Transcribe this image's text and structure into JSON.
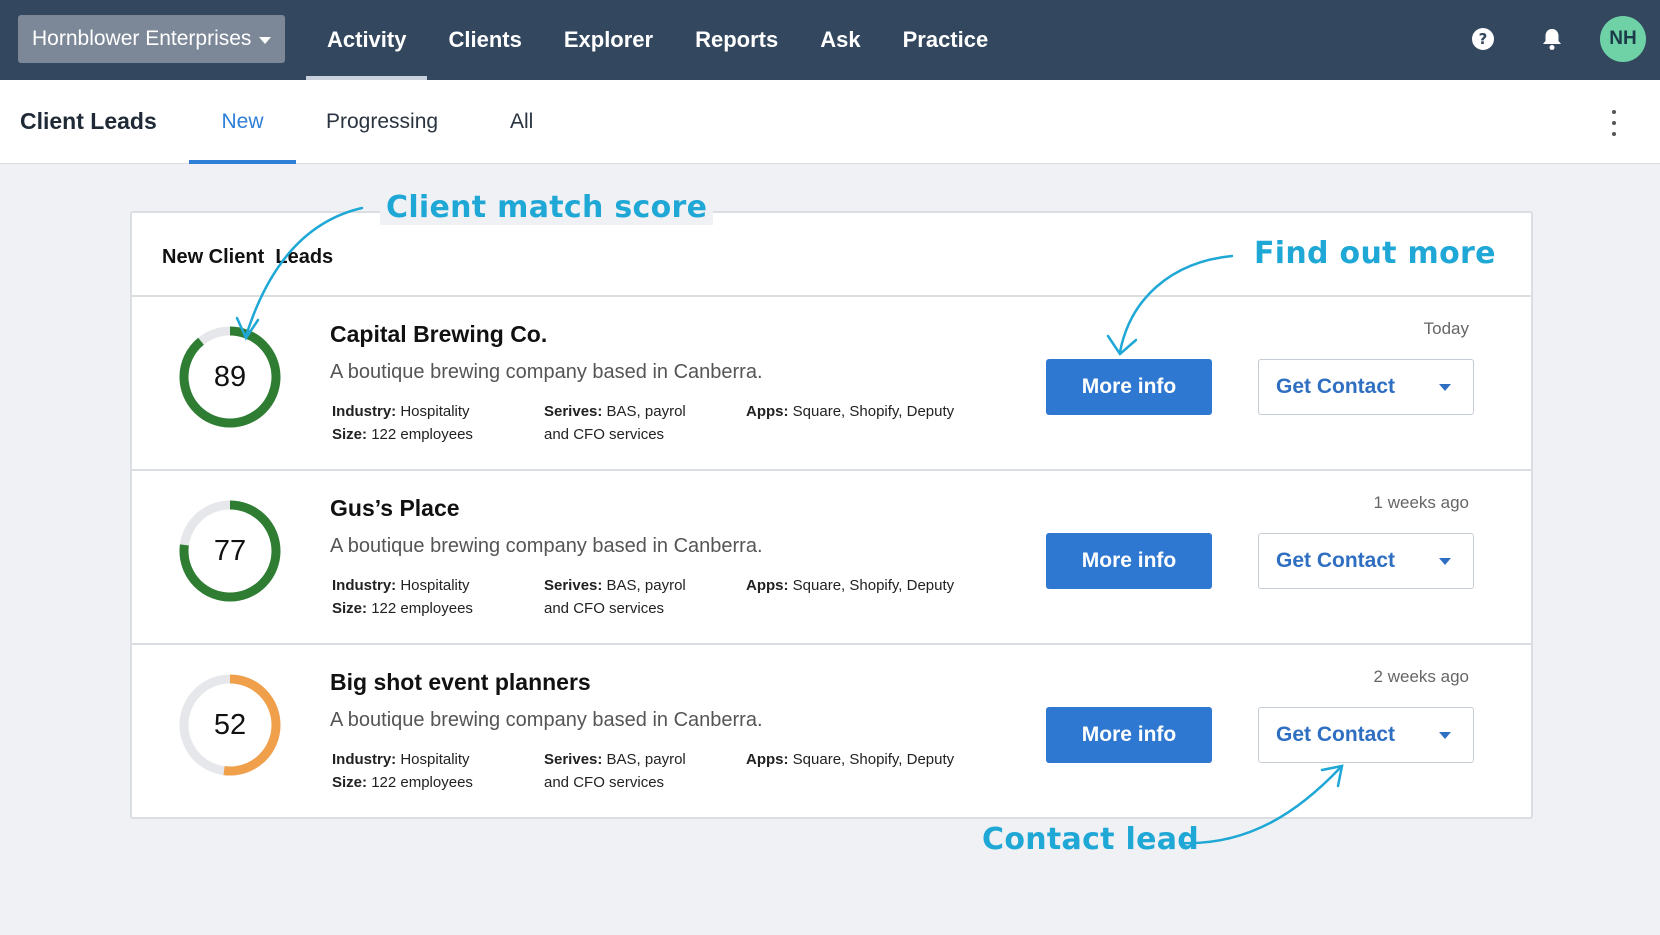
{
  "topbar": {
    "org_name": "Hornblower Enterprises",
    "nav": [
      "Activity",
      "Clients",
      "Explorer",
      "Reports",
      "Ask",
      "Practice"
    ],
    "active_nav": "Activity",
    "avatar_initials": "NH",
    "help_icon": "help-circle-icon",
    "bell_icon": "bell-icon"
  },
  "subheader": {
    "title": "Client Leads",
    "tabs": [
      "New",
      "Progressing",
      "All"
    ],
    "active_tab": "New"
  },
  "panel": {
    "title": "New Client  Leads",
    "leads": [
      {
        "score": 89,
        "score_color": "#2e7d32",
        "name": "Capital Brewing Co.",
        "description": "A boutique brewing company based in Canberra.",
        "industry_label": "Industry:",
        "industry": "Hospitality",
        "size_label": "Size:",
        "size": "122 employees",
        "serves_label": "Serives:",
        "serves_line1": "BAS, payrol",
        "serves_line2": "and CFO services",
        "apps_label": "Apps:",
        "apps": "Square, Shopify, Deputy",
        "time": "Today",
        "more_label": "More info",
        "contact_label": "Get Contact"
      },
      {
        "score": 77,
        "score_color": "#2e7d32",
        "name": "Gus’s Place",
        "description": "A boutique brewing company based in Canberra.",
        "industry_label": "Industry:",
        "industry": "Hospitality",
        "size_label": "Size:",
        "size": "122 employees",
        "serves_label": "Serives:",
        "serves_line1": "BAS, payrol",
        "serves_line2": "and CFO services",
        "apps_label": "Apps:",
        "apps": "Square, Shopify, Deputy",
        "time": "1 weeks ago",
        "more_label": "More info",
        "contact_label": "Get Contact"
      },
      {
        "score": 52,
        "score_color": "#f0a04b",
        "name": "Big shot event planners",
        "description": "A boutique brewing company based in Canberra.",
        "industry_label": "Industry:",
        "industry": "Hospitality",
        "size_label": "Size:",
        "size": "122 employees",
        "serves_label": "Serives:",
        "serves_line1": "BAS, payrol",
        "serves_line2": "and CFO services",
        "apps_label": "Apps:",
        "apps": "Square, Shopify, Deputy",
        "time": "2 weeks ago",
        "more_label": "More info",
        "contact_label": "Get Contact"
      }
    ]
  },
  "annotations": {
    "score": "Client match score",
    "more": "Find out more",
    "contact": "Contact lead",
    "color": "#1fa7d6"
  }
}
